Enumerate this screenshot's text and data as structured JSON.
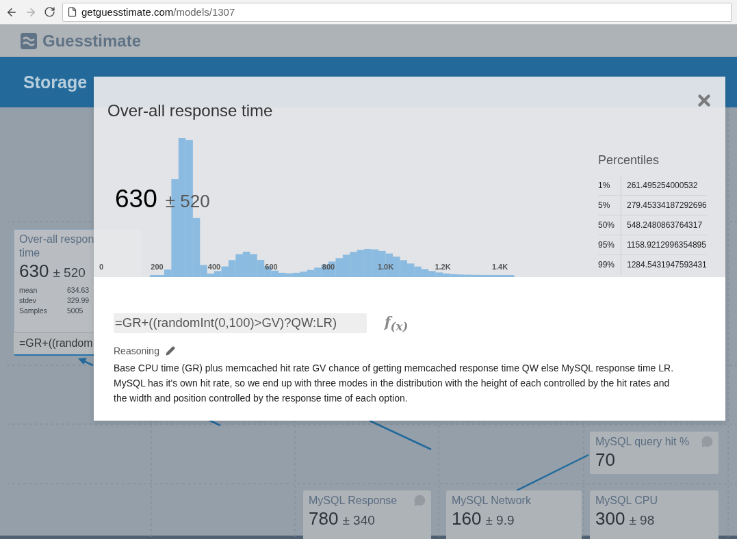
{
  "browser": {
    "url_host": "getguesstimate.com",
    "url_path": "/models/1307"
  },
  "header": {
    "logo": "Guesstimate"
  },
  "model": {
    "title": "Storage"
  },
  "cards": [
    {
      "title": "Over-all respon",
      "title_2": "time",
      "value": "630",
      "spread": "± 520",
      "stats": [
        {
          "label": "mean",
          "value": "634.63"
        },
        {
          "label": "stdev",
          "value": "329.99"
        },
        {
          "label": "Samples",
          "value": "5005"
        }
      ],
      "formula": "=GR+((random",
      "selected": true,
      "comment": false
    },
    {
      "title": "MySQL query hit %",
      "value": "70",
      "selected": false,
      "comment": true
    },
    {
      "title": "MySQL Response",
      "value": "780",
      "spread": "± 340",
      "selected": false,
      "comment": true
    },
    {
      "title": "MySQL Network",
      "value": "160",
      "spread": "± 9.9",
      "selected": false,
      "comment": false
    },
    {
      "title": "MySQL CPU",
      "value": "300",
      "spread": "± 98",
      "selected": false,
      "comment": false
    }
  ],
  "modal": {
    "title": "Over-all response time",
    "value": "630",
    "spread": "± 520",
    "axis_labels": [
      "0",
      "200",
      "400",
      "600",
      "800",
      "1.0K",
      "1.2K",
      "1.4K"
    ],
    "percentiles_title": "Percentiles",
    "percentiles": [
      {
        "pct": "1%",
        "value": "261.495254000532"
      },
      {
        "pct": "5%",
        "value": "279.45334187292696"
      },
      {
        "pct": "50%",
        "value": "548.2480863764317"
      },
      {
        "pct": "95%",
        "value": "1158.9212996354895"
      },
      {
        "pct": "99%",
        "value": "1284.5431947593431"
      }
    ],
    "formula": "=GR+((randomInt(0,100)>GV)?QW:LR)",
    "function_label": "f$_{(x)}$",
    "reasoning_label": "Reasoning",
    "reasoning": "Base CPU time (GR) plus memcached hit rate GV chance of getting memcached response time QW else MySQL response time LR. MySQL has it's own hit rate, so we end up with three modes in the distribution with the height of each controlled by the hit rates and the width and position controlled by the response time of each option."
  }
}
